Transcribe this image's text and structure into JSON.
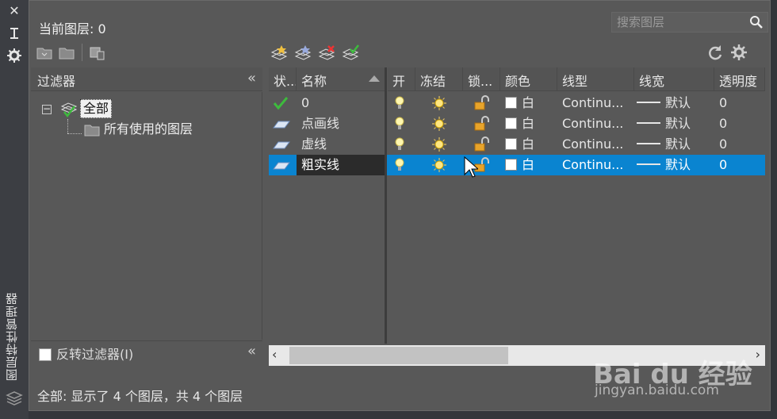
{
  "app": {
    "vertical_title": "图层特性管理器"
  },
  "header": {
    "current_layer": "当前图层: 0",
    "search_placeholder": "搜索图层"
  },
  "filters": {
    "title": "过滤器",
    "tree": [
      {
        "label": "全部",
        "selected": true
      },
      {
        "label": "所有使用的图层",
        "selected": false
      }
    ],
    "invert_label": "反转过滤器(I)",
    "invert_checked": false
  },
  "grid": {
    "columns": [
      "状...",
      "名称",
      "开",
      "冻结",
      "锁...",
      "颜色",
      "线型",
      "线宽",
      "透明度"
    ],
    "rows": [
      {
        "status": "current",
        "name": "0",
        "color": "白",
        "linetype": "Continu...",
        "lineweight": "默认",
        "transparency": "0",
        "selected": false
      },
      {
        "status": "layer",
        "name": "点画线",
        "color": "白",
        "linetype": "Continu...",
        "lineweight": "默认",
        "transparency": "0",
        "selected": false
      },
      {
        "status": "layer",
        "name": "虚线",
        "color": "白",
        "linetype": "Continu...",
        "lineweight": "默认",
        "transparency": "0",
        "selected": false
      },
      {
        "status": "layer",
        "name": "粗实线",
        "color": "白",
        "linetype": "Continu...",
        "lineweight": "默认",
        "transparency": "0",
        "selected": true
      }
    ]
  },
  "status_bar": {
    "text": "全部: 显示了 4 个图层，共 4 个图层"
  },
  "watermark": {
    "brand": "Bai du 经验",
    "url": "jingyan.baidu.com"
  },
  "colors": {
    "selection": "#0a84d0",
    "panel": "#585858",
    "current_check": "#3dbb3d"
  }
}
